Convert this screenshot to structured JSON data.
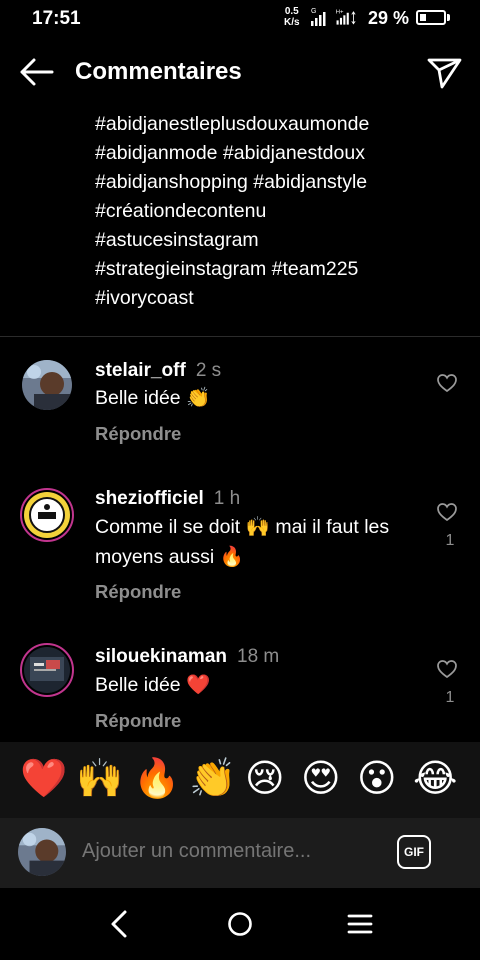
{
  "status": {
    "time": "17:51",
    "speed_value": "0.5",
    "speed_unit": "K/s",
    "network_g": "G",
    "network_h": "H+",
    "battery": "29 %",
    "battery_level": 0.29
  },
  "header": {
    "title": "Commentaires"
  },
  "caption": {
    "lines": [
      "#abidjanestleplusdouxaumonde",
      "#abidjanmode #abidjanestdoux",
      "#abidjanshopping #abidjanstyle",
      "#créationdecontenu",
      "#astucesinstagram",
      "#strategieinstagram #team225",
      "#ivorycoast"
    ]
  },
  "comments": [
    {
      "username": "stelair_off",
      "time": "2 s",
      "text_lines": [
        "Belle idée 👏"
      ],
      "reply": "Répondre",
      "likes": ""
    },
    {
      "username": "sheziofficiel",
      "time": "1 h",
      "text_lines": [
        "Comme il se doit 🙌 mai il faut les",
        "moyens aussi 🔥"
      ],
      "reply": "Répondre",
      "likes": "1"
    },
    {
      "username": "silouekinaman",
      "time": "18 m",
      "text_lines": [
        "Belle idée ❤️"
      ],
      "reply": "Répondre",
      "likes": "1"
    }
  ],
  "emoji_bar": [
    "❤️",
    "🙌",
    "🔥",
    "👏",
    "😢",
    "😍",
    "😮",
    "😂"
  ],
  "input": {
    "placeholder": "Ajouter un commentaire...",
    "gif_label": "GIF"
  },
  "icons": {
    "back": "arrow-left-icon",
    "send": "paper-plane-icon",
    "like": "heart-outline-icon",
    "nav_back": "chevron-left-icon",
    "nav_home": "circle-icon",
    "nav_menu": "menu-icon"
  }
}
